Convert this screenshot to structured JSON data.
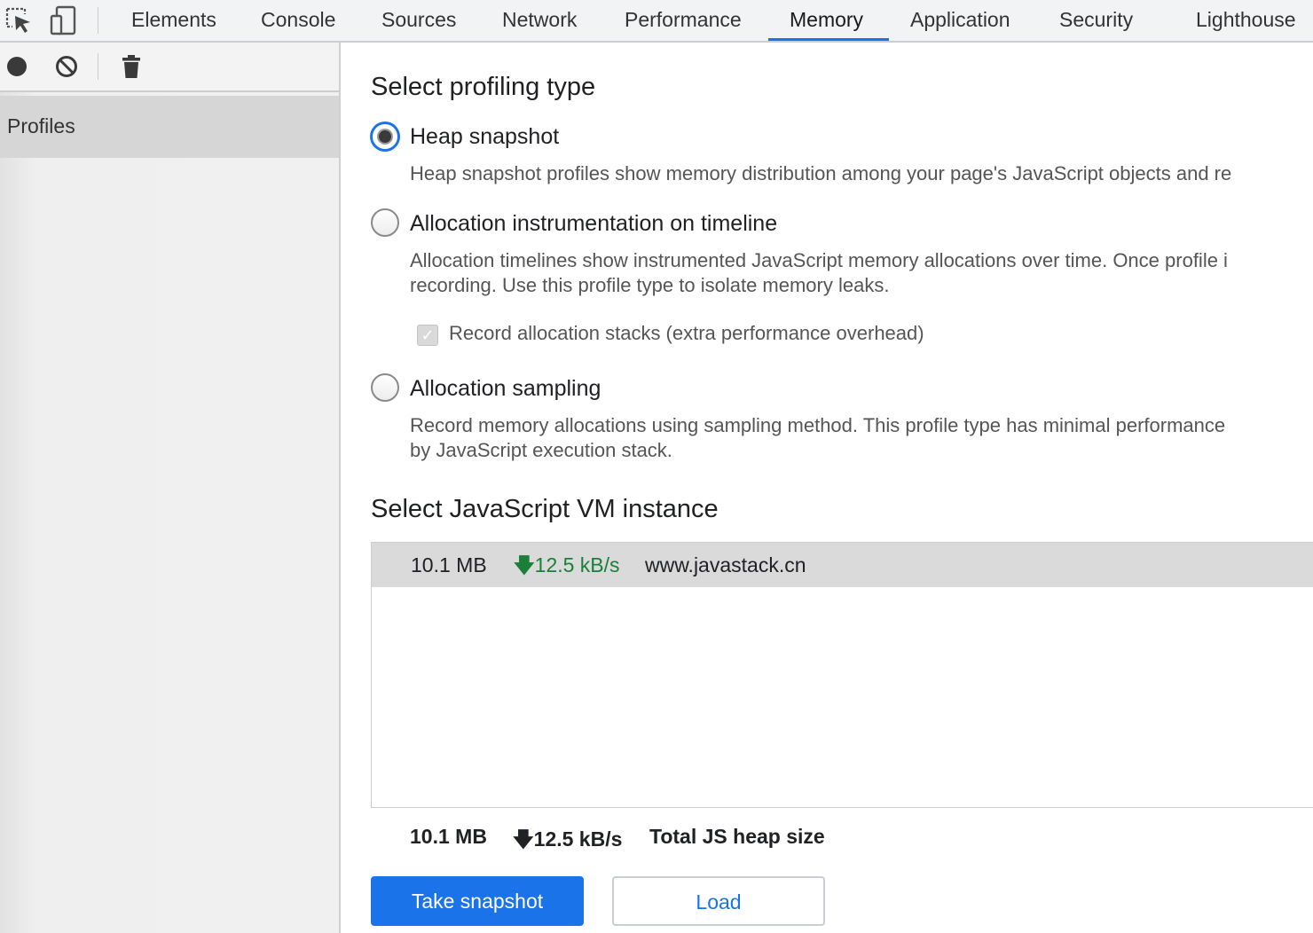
{
  "tabs": [
    {
      "label": "Elements"
    },
    {
      "label": "Console"
    },
    {
      "label": "Sources"
    },
    {
      "label": "Network"
    },
    {
      "label": "Performance"
    },
    {
      "label": "Memory"
    },
    {
      "label": "Application"
    },
    {
      "label": "Security"
    },
    {
      "label": "Lighthouse"
    }
  ],
  "selected_tab": "Memory",
  "toolbar_icons": [
    "inspect-element-icon",
    "device-toggle-icon"
  ],
  "sidebar": {
    "toolbar_icons": [
      "record-icon",
      "clear-icon",
      "garbage-collect-icon"
    ],
    "profiles_label": "Profiles"
  },
  "profiling": {
    "title": "Select profiling type",
    "options": [
      {
        "label": "Heap snapshot",
        "checked": true,
        "description": [
          "Heap snapshot profiles show memory distribution among your page's JavaScript objects and re"
        ]
      },
      {
        "label": "Allocation instrumentation on timeline",
        "checked": false,
        "description": [
          "Allocation timelines show instrumented JavaScript memory allocations over time. Once profile i",
          "recording. Use this profile type to isolate memory leaks."
        ]
      },
      {
        "label": "Allocation sampling",
        "checked": false,
        "description": [
          "Record memory allocations using sampling method. This profile type has minimal performance",
          "by JavaScript execution stack."
        ]
      }
    ],
    "record_stacks": {
      "label": "Record allocation stacks (extra performance overhead)",
      "checked": true,
      "disabled": true
    }
  },
  "vm": {
    "title": "Select JavaScript VM instance",
    "instances": [
      {
        "size": "10.1 MB",
        "rate_arrow": "🡇",
        "rate": "12.5 kB/s",
        "url": "www.javastack.cn"
      }
    ],
    "summary": {
      "size": "10.1 MB",
      "rate_arrow": "🡇",
      "rate": "12.5 kB/s",
      "label": "Total JS heap size"
    }
  },
  "buttons": {
    "take_snapshot": "Take snapshot",
    "load": "Load"
  },
  "colors": {
    "accent": "#1a73e8",
    "rate_green": "#188038",
    "selected_row": "#dadada"
  }
}
